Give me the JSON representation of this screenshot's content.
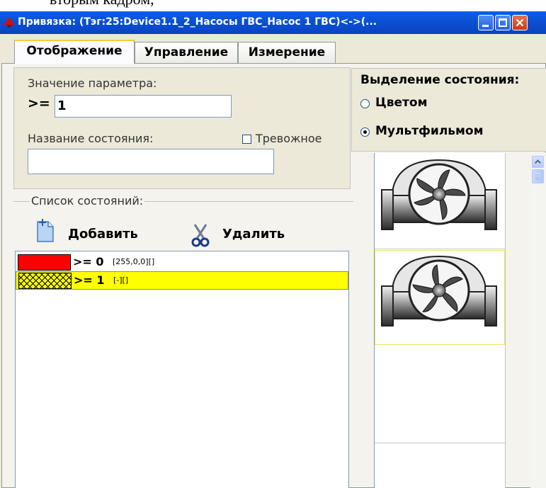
{
  "background_text": "вторым кадром,",
  "window": {
    "title": "Привязка: (Тэг:25:Device1.1_2_Насосы ГВС_Насос 1 ГВС)<->(..."
  },
  "tabs": [
    {
      "label": "Отображение",
      "active": true
    },
    {
      "label": "Управление",
      "active": false
    },
    {
      "label": "Измерение",
      "active": false
    }
  ],
  "param": {
    "value_label": "Значение параметра:",
    "operator": ">=",
    "value": "1",
    "state_name_label": "Название состояния:",
    "state_name_value": "",
    "alarm_label": "Тревожное",
    "alarm_checked": false
  },
  "highlight": {
    "title": "Выделение состояния:",
    "options": [
      {
        "label": "Цветом",
        "selected": false
      },
      {
        "label": "Мультфильмом",
        "selected": true
      }
    ]
  },
  "state_list": {
    "title": "Список состояний:",
    "add_label": "Добавить",
    "delete_label": "Удалить",
    "rows": [
      {
        "condition": ">= 0",
        "info": "[255,0,0][]",
        "color": "#ff0000",
        "selected": false
      },
      {
        "condition": ">= 1",
        "info": "[-][]",
        "color": "#ffff00",
        "selected": true
      }
    ]
  },
  "frames": [
    {
      "icon": "fan-pump-icon",
      "selected": false
    },
    {
      "icon": "fan-pump-icon",
      "selected": true
    },
    {
      "icon": "empty",
      "selected": false
    },
    {
      "icon": "empty",
      "selected": false
    }
  ],
  "colors": {
    "titlebar": "#0b4fd1",
    "selection": "#ffff00",
    "red_state": "#ff0000"
  }
}
